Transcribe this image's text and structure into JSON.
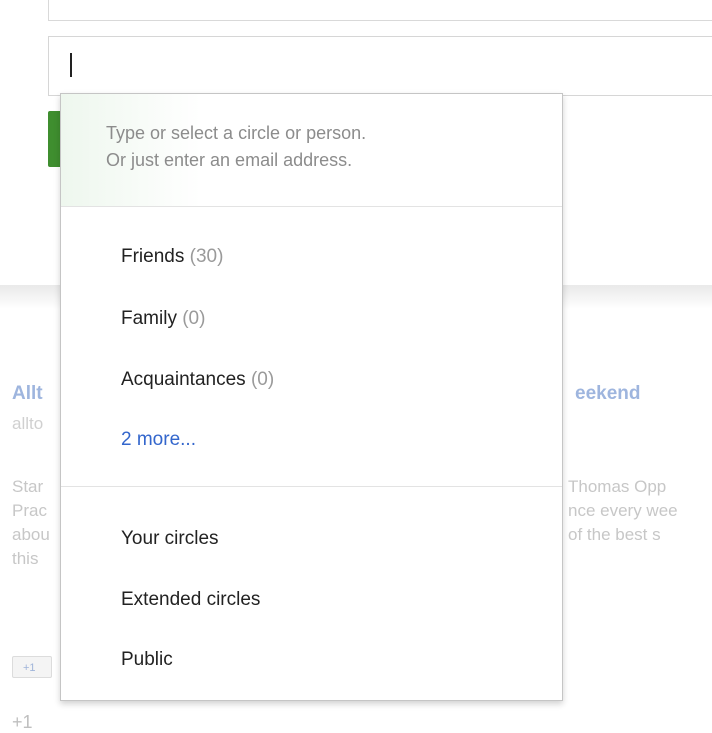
{
  "background": {
    "post_title_left": "Allt",
    "post_title_right": "eekend",
    "post_meta": "allto",
    "post_text_left": [
      "Star",
      "Prac",
      "abou",
      "this"
    ],
    "post_text_right": [
      "Thomas Opp",
      "nce every wee",
      "of the best s"
    ],
    "plus_badge": "+1",
    "plus_count": "+1"
  },
  "recipient_input": {
    "value": ""
  },
  "dropdown": {
    "hint_line1": "Type or select a circle or person.",
    "hint_line2": "Or just enter an email address.",
    "circles": [
      {
        "label": "Friends",
        "count": "(30)"
      },
      {
        "label": "Family",
        "count": "(0)"
      },
      {
        "label": "Acquaintances",
        "count": "(0)"
      }
    ],
    "more_label": "2 more...",
    "scopes": [
      "Your circles",
      "Extended circles",
      "Public"
    ]
  }
}
